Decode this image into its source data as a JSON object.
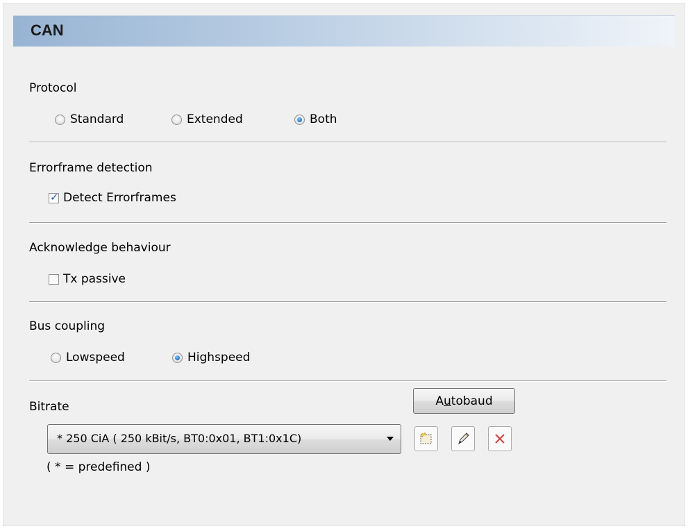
{
  "header": {
    "title": "CAN"
  },
  "protocol": {
    "label": "Protocol",
    "options": [
      "Standard",
      "Extended",
      "Both"
    ],
    "selected": "Both"
  },
  "errorframe": {
    "label": "Errorframe detection",
    "checkbox_label": "Detect Errorframes",
    "checked": true
  },
  "acknowledge": {
    "label": "Acknowledge behaviour",
    "checkbox_label": "Tx passive",
    "checked": false
  },
  "bus_coupling": {
    "label": "Bus coupling",
    "options": [
      "Lowspeed",
      "Highspeed"
    ],
    "selected": "Highspeed"
  },
  "bitrate": {
    "label": "Bitrate",
    "autobaud_prefix": "A",
    "autobaud_accel": "u",
    "autobaud_suffix": "tobaud",
    "selected_value": "*    250 CiA ( 250 kBit/s, BT0:0x01, BT1:0x1C)",
    "note": "( * = predefined )"
  },
  "icons": [
    "new-bitrate-icon",
    "edit-pencil-icon",
    "delete-x-icon",
    "dropdown-arrow-icon"
  ],
  "colors": {
    "radio_fill": "#2a6fb8",
    "check": "#2a5ea8",
    "delete": "#d43a3a"
  }
}
